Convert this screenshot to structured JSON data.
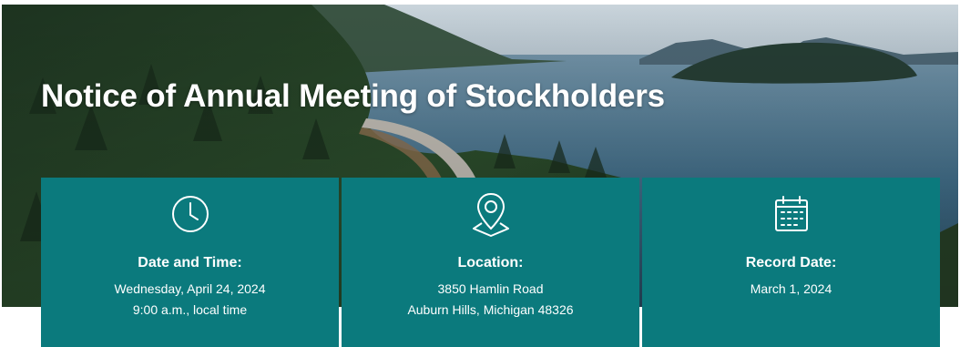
{
  "title": "Notice of Annual Meeting of Stockholders",
  "colors": {
    "card_background": "#0b7a7d",
    "text": "#ffffff"
  },
  "cards": [
    {
      "icon": "clock-icon",
      "label": "Date and Time:",
      "line1": "Wednesday, April 24, 2024",
      "line2": "9:00 a.m., local time"
    },
    {
      "icon": "map-pin-icon",
      "label": "Location:",
      "line1": "3850 Hamlin Road",
      "line2": "Auburn Hills, Michigan 48326"
    },
    {
      "icon": "calendar-icon",
      "label": "Record Date:",
      "line1": "March 1, 2024",
      "line2": ""
    }
  ]
}
